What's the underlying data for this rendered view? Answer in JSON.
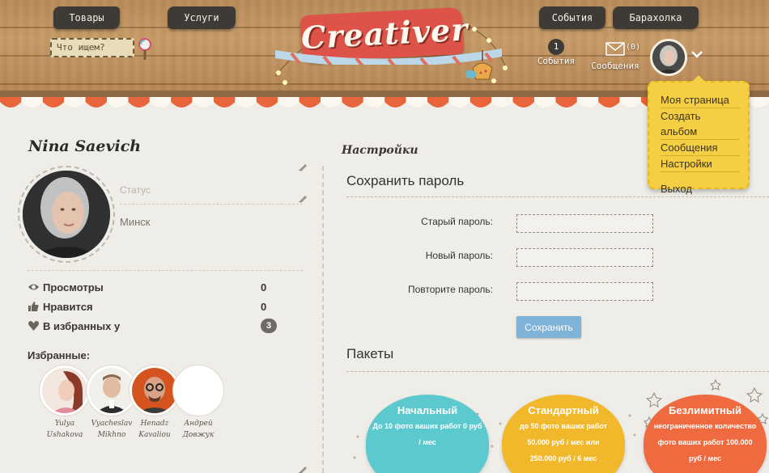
{
  "header": {
    "nav_left": [
      "Товары",
      "Услуги"
    ],
    "nav_right": [
      "События",
      "Барахолка"
    ],
    "search_placeholder": "Что ищем?",
    "logo_text": "Creativer",
    "events_count": "1",
    "events_label": "События",
    "messages_count": "(0)",
    "messages_label": "Сообщения"
  },
  "user_menu": {
    "items": [
      "Моя страница",
      "Создать альбом",
      "Сообщения",
      "Настройки"
    ],
    "logout": "Выход"
  },
  "profile": {
    "name": "Nina Saevich",
    "status_placeholder": "Статус",
    "city": "Минск",
    "stats": [
      {
        "label": "Просмотры",
        "value": "0"
      },
      {
        "label": "Нравится",
        "value": "0"
      },
      {
        "label": "В избранных у",
        "value": "3"
      }
    ],
    "favorites_title": "Избранные:",
    "favorites": [
      {
        "first": "Yulya",
        "last": "Ushakova"
      },
      {
        "first": "Vyacheslav",
        "last": "Mikhno"
      },
      {
        "first": "Henadz",
        "last": "Kavaliou"
      },
      {
        "first": "Андрей",
        "last": "Довжук"
      }
    ]
  },
  "settings": {
    "heading": "Настройки",
    "password_section": "Сохранить пароль",
    "old_password_label": "Старый пароль:",
    "new_password_label": "Новый пароль:",
    "repeat_password_label": "Повторите пароль:",
    "save_button": "Сохранить",
    "packages_section": "Пакеты",
    "packages": [
      {
        "title": "Начальный",
        "desc1": "До 10 фото ваших работ 0 руб",
        "desc2": "/ мес",
        "desc3": "",
        "color": "#5cc9cf"
      },
      {
        "title": "Стандартный",
        "desc1": "до 50 фото ваших работ",
        "desc2": "50.000 руб / мес или",
        "desc3": "250.000 руб / 6 мес",
        "color": "#f2b82c"
      },
      {
        "title": "Безлимитный",
        "desc1": "неограниченное количество",
        "desc2": "фото ваших работ 100.000",
        "desc3": "руб / мес",
        "color": "#f06a3f"
      }
    ]
  },
  "colors": {
    "wood": "#c79b66",
    "menu_yellow": "#f5cf43",
    "save_blue": "#7fb3d8",
    "logo_red": "#dd5349"
  }
}
